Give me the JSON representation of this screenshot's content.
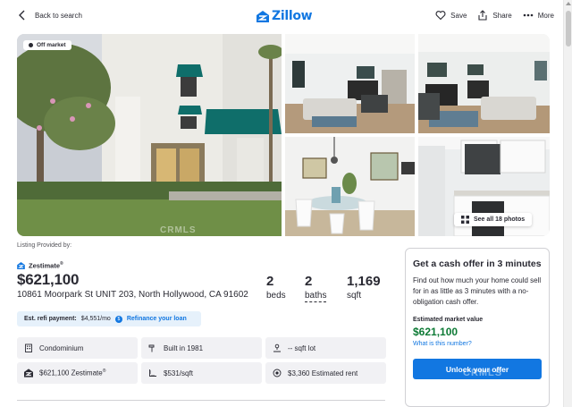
{
  "header": {
    "back_label": "Back to search",
    "logo_text": "Zillow",
    "save_label": "Save",
    "share_label": "Share",
    "more_label": "More"
  },
  "gallery": {
    "status_badge": "Off market",
    "see_all_label": "See all 18 photos",
    "watermark": "CRMLS"
  },
  "listing": {
    "provided_by": "Listing Provided by:",
    "zestimate_label": "Zestimate",
    "zestimate_mark": "®",
    "price": "$621,100",
    "address": "10861 Moorpark St UNIT 203, North Hollywood, CA 91602",
    "beds": {
      "value": "2",
      "label": "beds"
    },
    "baths": {
      "value": "2",
      "label": "baths"
    },
    "sqft": {
      "value": "1,169",
      "label": "sqft"
    }
  },
  "refi": {
    "label": "Est. refi payment:",
    "amount": "$4,551/mo",
    "link": "Refinance your loan"
  },
  "facts": [
    {
      "icon": "building-icon",
      "text": "Condominium"
    },
    {
      "icon": "hammer-icon",
      "text": "Built in 1981"
    },
    {
      "icon": "lot-icon",
      "text": "-- sqft lot"
    },
    {
      "icon": "zestimate-house-icon",
      "text": "$621,100 Zestimate",
      "mark": "®"
    },
    {
      "icon": "ruler-icon",
      "text": "$531/sqft"
    },
    {
      "icon": "rent-icon",
      "text": "$3,360 Estimated rent"
    }
  ],
  "cash_offer": {
    "title": "Get a cash offer in 3 minutes",
    "description": "Find out how much your home could sell for in as little as 3 minutes with a no-obligation cash offer.",
    "market_value_label": "Estimated market value",
    "market_value": "$621,100",
    "what_link": "What is this number?",
    "button_label": "Unlock your offer",
    "watermark": "CRMLS"
  },
  "colors": {
    "brand_blue": "#1277e1",
    "value_green": "#0d7a35",
    "awning_teal": "#0f6e6a"
  }
}
